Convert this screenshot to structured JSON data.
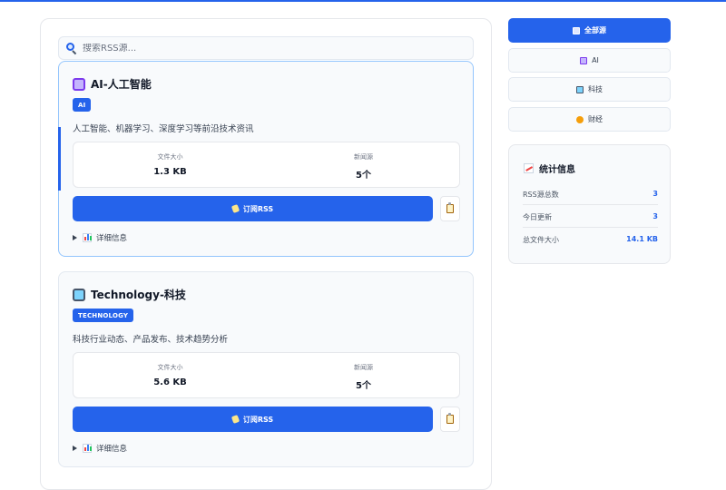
{
  "search": {
    "placeholder": "搜索RSS源..."
  },
  "feeds": [
    {
      "title": "AI-人工智能",
      "icon": "robot-icon",
      "tag": "AI",
      "description": "人工智能、机器学习、深度学习等前沿技术资讯",
      "file_size_label": "文件大小",
      "file_size": "1.3 KB",
      "news_source_label": "新闻源",
      "news_source": "5个",
      "subscribe_label": "订阅RSS",
      "details_label": "详细信息",
      "active": true
    },
    {
      "title": "Technology-科技",
      "icon": "computer-icon",
      "tag": "TECHNOLOGY",
      "description": "科技行业动态、产品发布、技术趋势分析",
      "file_size_label": "文件大小",
      "file_size": "5.6 KB",
      "news_source_label": "新闻源",
      "news_source": "5个",
      "subscribe_label": "订阅RSS",
      "details_label": "详细信息",
      "active": false
    }
  ],
  "sidebar": {
    "filters": [
      {
        "label": "全部源",
        "icon": "bar-chart-icon",
        "active": true
      },
      {
        "label": "AI",
        "icon": "robot-icon",
        "active": false
      },
      {
        "label": "科技",
        "icon": "computer-icon",
        "active": false
      },
      {
        "label": "财经",
        "icon": "money-bag-icon",
        "active": false
      }
    ]
  },
  "stats": {
    "title": "统计信息",
    "icon": "trend-chart-icon",
    "rows": [
      {
        "label": "RSS源总数",
        "value": "3"
      },
      {
        "label": "今日更新",
        "value": "3"
      },
      {
        "label": "总文件大小",
        "value": "14.1 KB"
      }
    ]
  },
  "colors": {
    "accent": "#2563eb",
    "card_bg": "#f8fafc",
    "border": "#e2e8f0"
  }
}
